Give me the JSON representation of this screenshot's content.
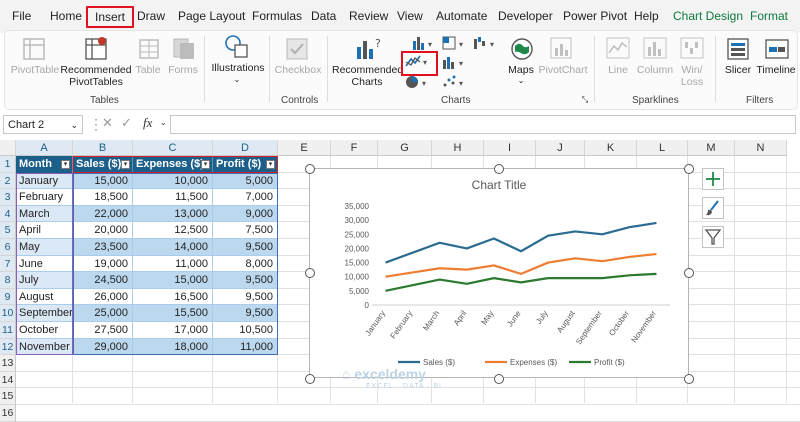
{
  "menu": {
    "tabs": [
      "File",
      "Home",
      "Insert",
      "Draw",
      "Page Layout",
      "Formulas",
      "Data",
      "Review",
      "View",
      "Automate",
      "Developer",
      "Power Pivot",
      "Help",
      "Chart Design",
      "Format"
    ]
  },
  "ribbon": {
    "pivottable": "PivotTable",
    "recommended_pivot_1": "Recommended",
    "recommended_pivot_2": "PivotTables",
    "table": "Table",
    "forms": "Forms",
    "tables_group": "Tables",
    "illustrations": "Illustrations",
    "checkbox": "Checkbox",
    "controls_group": "Controls",
    "recommended_charts_1": "Recommended",
    "recommended_charts_2": "Charts",
    "maps": "Maps",
    "pivotchart": "PivotChart",
    "charts_group": "Charts",
    "line": "Line",
    "column": "Column",
    "winloss_1": "Win/",
    "winloss_2": "Loss",
    "sparklines_group": "Sparklines",
    "slicer": "Slicer",
    "timeline": "Timeline",
    "filters_group": "Filters"
  },
  "formula_bar": {
    "name_box": "Chart 2",
    "fx": "fx",
    "value": ""
  },
  "sheet": {
    "columns": [
      "A",
      "B",
      "C",
      "D",
      "E",
      "F",
      "G",
      "H",
      "I",
      "J",
      "K",
      "L",
      "M",
      "N"
    ],
    "rows": [
      "1",
      "2",
      "3",
      "4",
      "5",
      "6",
      "7",
      "8",
      "9",
      "10",
      "11",
      "12",
      "13",
      "14",
      "15",
      "16"
    ],
    "headers": [
      "Month",
      "Sales ($)",
      "Expenses ($)",
      "Profit ($)"
    ],
    "data": [
      [
        "January",
        "15,000",
        "10,000",
        "5,000"
      ],
      [
        "February",
        "18,500",
        "11,500",
        "7,000"
      ],
      [
        "March",
        "22,000",
        "13,000",
        "9,000"
      ],
      [
        "April",
        "20,000",
        "12,500",
        "7,500"
      ],
      [
        "May",
        "23,500",
        "14,000",
        "9,500"
      ],
      [
        "June",
        "19,000",
        "11,000",
        "8,000"
      ],
      [
        "July",
        "24,500",
        "15,000",
        "9,500"
      ],
      [
        "August",
        "26,000",
        "16,500",
        "9,500"
      ],
      [
        "September",
        "25,000",
        "15,500",
        "9,500"
      ],
      [
        "October",
        "27,500",
        "17,000",
        "10,500"
      ],
      [
        "November",
        "29,000",
        "18,000",
        "11,000"
      ]
    ]
  },
  "chart_data": {
    "type": "line",
    "title": "Chart Title",
    "categories": [
      "January",
      "February",
      "March",
      "April",
      "May",
      "June",
      "July",
      "August",
      "September",
      "October",
      "November"
    ],
    "series": [
      {
        "name": "Sales ($)",
        "color": "#2a6c91",
        "values": [
          15000,
          18500,
          22000,
          20000,
          23500,
          19000,
          24500,
          26000,
          25000,
          27500,
          29000
        ]
      },
      {
        "name": "Expenses ($)",
        "color": "#ed7d31",
        "values": [
          10000,
          11500,
          13000,
          12500,
          14000,
          11000,
          15000,
          16500,
          15500,
          17000,
          18000
        ]
      },
      {
        "name": "Profit ($)",
        "color": "#2b7a2f",
        "values": [
          5000,
          7000,
          9000,
          7500,
          9500,
          8000,
          9500,
          9500,
          9500,
          10500,
          11000
        ]
      }
    ],
    "yticks": [
      "35,000",
      "30,000",
      "25,000",
      "20,000",
      "15,000",
      "10,000",
      "5,000",
      "0"
    ],
    "ylim": [
      0,
      35000
    ],
    "grid": false,
    "legend": "bottom"
  },
  "watermark": {
    "name": "exceldemy",
    "tagline": "EXCEL · DATA · BI"
  }
}
